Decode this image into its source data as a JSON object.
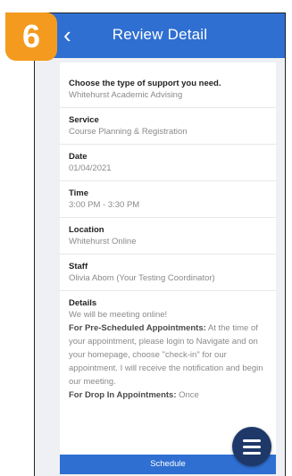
{
  "badge": {
    "number": "6"
  },
  "header": {
    "back_icon": "‹",
    "title": "Review Detail"
  },
  "fields": [
    {
      "label": "Choose the type of support you need.",
      "value": "Whitehurst Academic Advising"
    },
    {
      "label": "Service",
      "value": "Course Planning & Registration"
    },
    {
      "label": "Date",
      "value": "01/04/2021"
    },
    {
      "label": "Time",
      "value": "3:00 PM - 3:30 PM"
    },
    {
      "label": "Location",
      "value": "Whitehurst Online"
    },
    {
      "label": "Staff",
      "value": "Olivia Abom (Your Testing Coordinator)"
    }
  ],
  "details": {
    "label": "Details",
    "line1": "We will be meeting online!",
    "p1_bold": "For Pre-Scheduled Appointments:",
    "p1_text": " At the time of your appointment, please login to Navigate and on your homepage, choose \"check-in\" for our appointment. I will receive the notification and begin our meeting.",
    "p2_bold": "For Drop In Appointments:",
    "p2_text": " Once"
  },
  "schedule_button": {
    "label": "Schedule"
  },
  "fab": {
    "icon": "menu-icon"
  },
  "colors": {
    "header": "#2f6fd2",
    "badge": "#f39a1f",
    "fab": "#1e3869"
  }
}
